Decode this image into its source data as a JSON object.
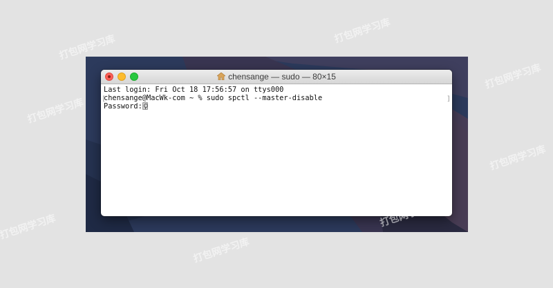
{
  "window": {
    "title": "chensange — sudo — 80×15",
    "title_icon": "home-folder-icon"
  },
  "terminal": {
    "lines": [
      "Last login: Fri Oct 18 17:56:57 on ttys000",
      "chensange@MacWk-com ~ % sudo spctl --master-disable",
      "Password:"
    ],
    "cursor_icon": "key-icon"
  },
  "watermark": "打包网学习库",
  "colors": {
    "close": "#fc5f57",
    "minimize": "#fdbc2e",
    "zoom": "#28c840",
    "background": "#e3e3e3"
  }
}
